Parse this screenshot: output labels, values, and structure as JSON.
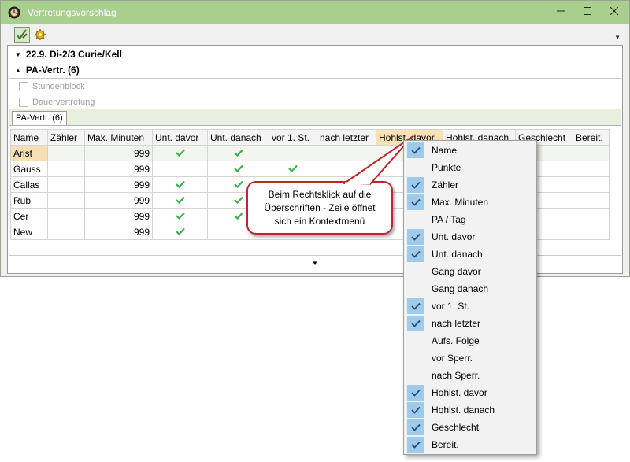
{
  "window": {
    "title": "Vertretungsvorschlag",
    "accent": "#a9cf8f"
  },
  "groups": {
    "lesson": "22.9. Di-2/3 Curie/Kell",
    "pa": "PA-Vertr. (6)"
  },
  "options": {
    "stundenblock": "Stundenblock",
    "dauervertretung": "Dauervertretung"
  },
  "tab": "PA-Vertr. (6)",
  "table": {
    "columns": [
      "Name",
      "Zähler",
      "Max. Minuten",
      "Unt. davor",
      "Unt. danach",
      "vor 1. St.",
      "nach letzter",
      "Hohlst. davor",
      "Hohlst. danach",
      "Geschlecht",
      "Bereit."
    ],
    "rows": [
      {
        "name": "Arist",
        "max": "999",
        "unt_davor": true,
        "unt_danach": true,
        "vor1": false
      },
      {
        "name": "Gauss",
        "max": "999",
        "unt_davor": false,
        "unt_danach": true,
        "vor1": true
      },
      {
        "name": "Callas",
        "max": "999",
        "unt_davor": true,
        "unt_danach": true,
        "vor1": false
      },
      {
        "name": "Rub",
        "max": "999",
        "unt_davor": true,
        "unt_danach": true,
        "vor1": false
      },
      {
        "name": "Cer",
        "max": "999",
        "unt_davor": true,
        "unt_danach": true,
        "vor1": false
      },
      {
        "name": "New",
        "max": "999",
        "unt_davor": true,
        "unt_danach": false,
        "vor1": false
      }
    ]
  },
  "callout": {
    "line1": "Beim Rechtsklick auf die",
    "line2": "Überschriften - Zeile öffnet",
    "line3": "sich ein Kontextmenü"
  },
  "context_menu": {
    "items": [
      {
        "label": "Name",
        "checked": true
      },
      {
        "label": "Punkte",
        "checked": false
      },
      {
        "label": "Zähler",
        "checked": true
      },
      {
        "label": "Max. Minuten",
        "checked": true
      },
      {
        "label": "PA / Tag",
        "checked": false
      },
      {
        "label": "Unt. davor",
        "checked": true
      },
      {
        "label": "Unt. danach",
        "checked": true
      },
      {
        "label": "Gang davor",
        "checked": false
      },
      {
        "label": "Gang danach",
        "checked": false
      },
      {
        "label": "vor 1. St.",
        "checked": true
      },
      {
        "label": "nach letzter",
        "checked": true
      },
      {
        "label": "Aufs. Folge",
        "checked": false
      },
      {
        "label": "vor Sperr.",
        "checked": false
      },
      {
        "label": "nach Sperr.",
        "checked": false
      },
      {
        "label": "Hohlst. davor",
        "checked": true
      },
      {
        "label": "Hohlst. danach",
        "checked": true
      },
      {
        "label": "Geschlecht",
        "checked": true
      },
      {
        "label": "Bereit.",
        "checked": true
      }
    ]
  }
}
